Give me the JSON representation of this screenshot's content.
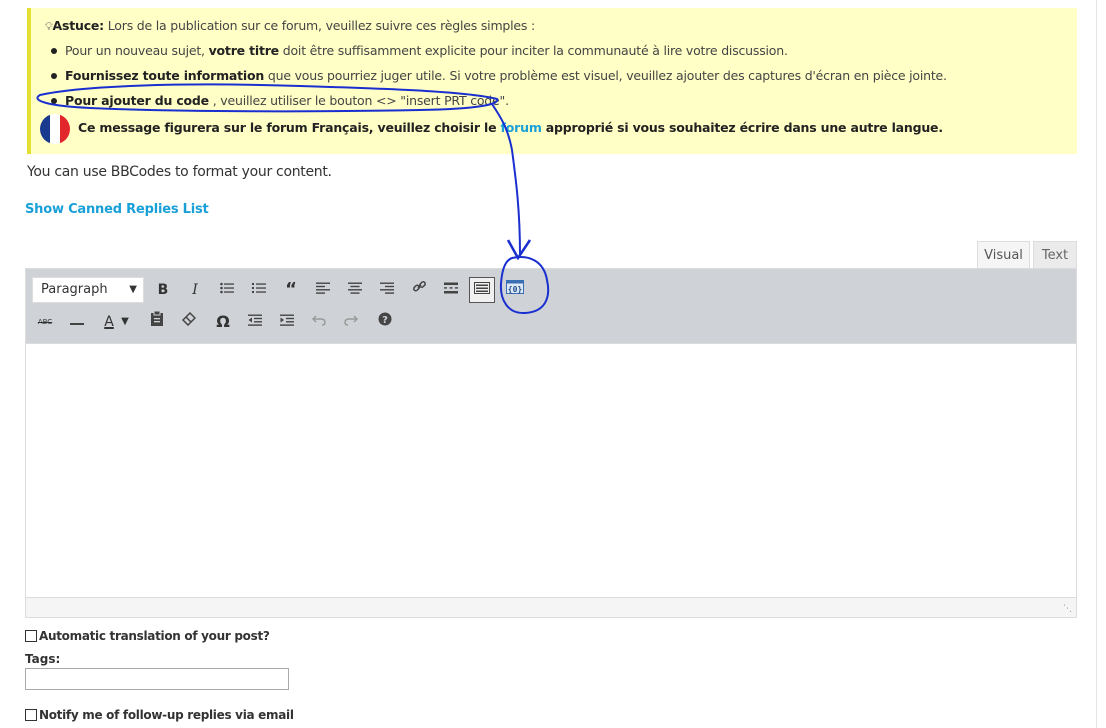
{
  "tip": {
    "label": "Astuce:",
    "intro": " Lors de la publication sur ce forum, veuillez suivre ces règles simples :",
    "item1_pre": "Pour un nouveau sujet, ",
    "item1_bold": "votre titre",
    "item1_post": " doit être suffisamment explicite pour inciter la communauté à lire votre discussion.",
    "item2_bold": "Fournissez toute information",
    "item2_post": " que vous pourriez juger utile. Si votre problème est visuel, veuillez ajouter des captures d'écran en pièce jointe.",
    "item3_bold": "Pour ajouter du code",
    "item3_post": " , veuillez utiliser le bouton <> \"insert PRT code\".",
    "lang_pre": "Ce message figurera sur le forum Français, veuillez choisir le ",
    "lang_link": "forum",
    "lang_post": " approprié si vous souhaitez écrire dans une autre langue."
  },
  "bbcode_note": "You can use BBCodes to format your content.",
  "canned_replies_link": "Show Canned Replies List",
  "editor": {
    "tab_visual": "Visual",
    "tab_text": "Text",
    "format_select": "Paragraph",
    "bold": "B",
    "italic": "I",
    "text_color": "A",
    "special_char": "Ω",
    "strikethrough": "ABC"
  },
  "auto_translate_label": "Automatic translation of your post?",
  "tags_label": "Tags:",
  "notify_label": "Notify me of follow-up replies via email",
  "colors": {
    "tip_bg": "#ffffc6",
    "link": "#1aa0d8",
    "toolbar_bg": "#cfd3d7",
    "annotation": "#1a2fd0"
  }
}
